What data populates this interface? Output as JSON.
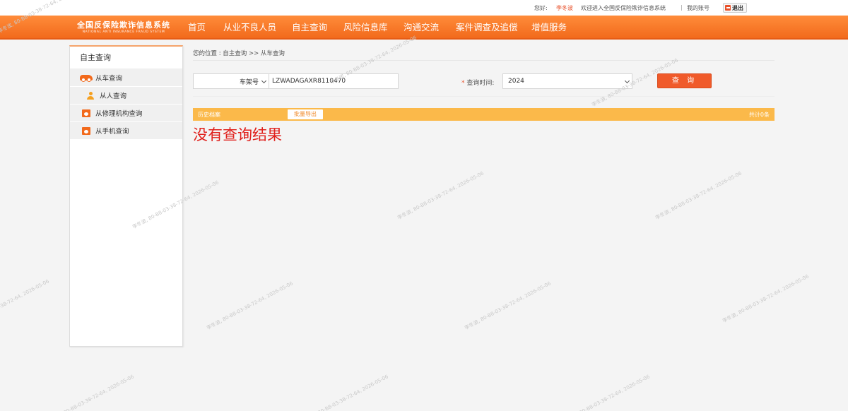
{
  "topbar": {
    "greeting": "您好:",
    "username": "李冬波",
    "welcome": "欢迎进入全国反保险欺诈信息系统",
    "separator": "|",
    "my_account": "我的账号",
    "logout": "退出"
  },
  "logo": {
    "title_cn": "全国反保险欺诈信息系统",
    "title_en": "NATIONAL ANTI INSURANCE FRAUD SYSTEM"
  },
  "nav": {
    "items": [
      "首页",
      "从业不良人员",
      "自主查询",
      "风险信息库",
      "沟通交流",
      "案件调查及追偿",
      "增值服务"
    ]
  },
  "sidebar": {
    "title": "自主查询",
    "items": [
      "从车查询",
      "从人查询",
      "从修理机构查询",
      "从手机查询"
    ]
  },
  "breadcrumb": "您的位置 : 自主查询 >> 从车查询",
  "form": {
    "field_type": "车架号",
    "vin_value": "LZWADAGAXR8110470",
    "time_label": "查询时间:",
    "time_required": "*",
    "time_value": "2024",
    "query_button": "查 询"
  },
  "result": {
    "history_label": "历史档案",
    "export_button": "批量导出",
    "total": "共计0条",
    "empty_message": "没有查询结果"
  },
  "watermark": "李冬波, 80-B8-03-38-72-64, 2026-05-06"
}
